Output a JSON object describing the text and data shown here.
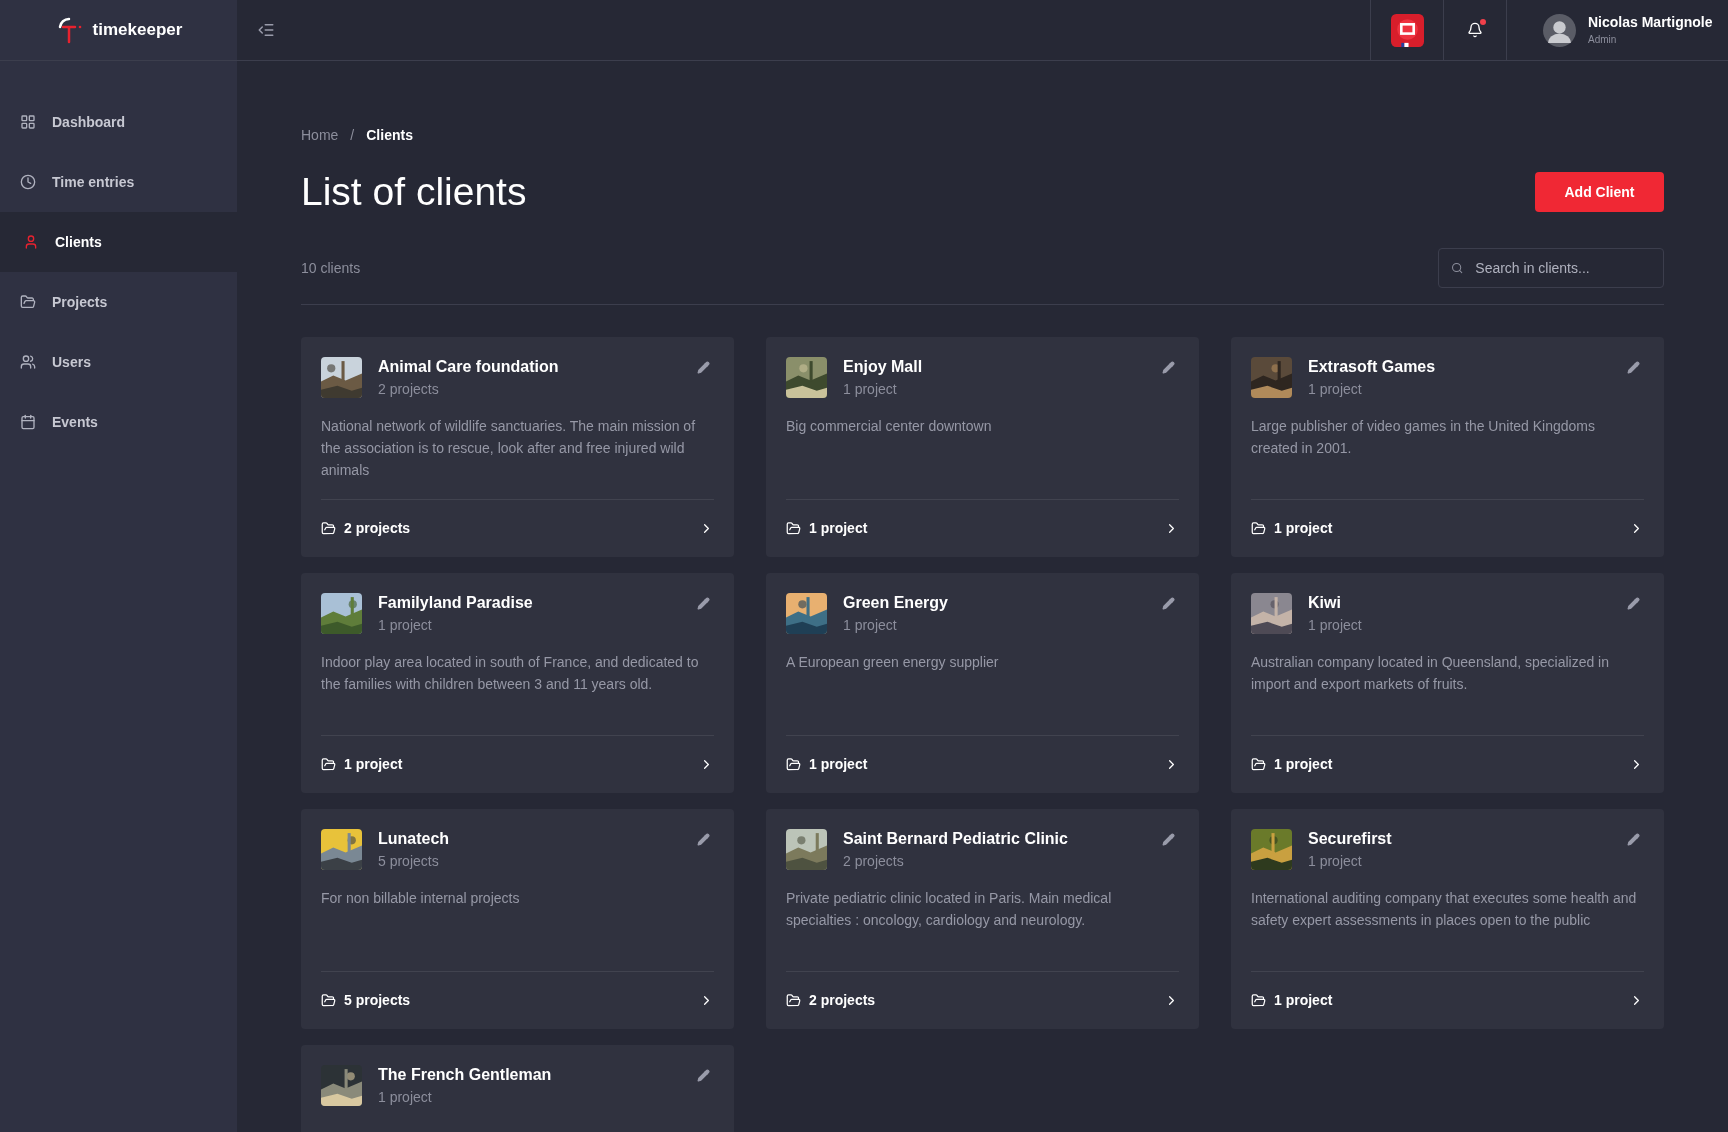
{
  "brand": {
    "name": "timekeeper"
  },
  "sidebar": {
    "items": [
      {
        "label": "Dashboard",
        "selected": false
      },
      {
        "label": "Time entries",
        "selected": false
      },
      {
        "label": "Clients",
        "selected": true
      },
      {
        "label": "Projects",
        "selected": false
      },
      {
        "label": "Users",
        "selected": false
      },
      {
        "label": "Events",
        "selected": false
      }
    ]
  },
  "user": {
    "name": "Nicolas Martignole",
    "role": "Admin",
    "notifications": true
  },
  "breadcrumb": {
    "items": [
      "Home",
      "Clients"
    ],
    "separator": "/"
  },
  "title": "List of clients",
  "add_button": "Add Client",
  "count": "10 clients",
  "search": {
    "placeholder": "Search in clients..."
  },
  "clients": [
    {
      "name": "Animal Care foundation",
      "subtitle": "2 projects",
      "description": "National network of wildlife sanctuaries. The main mission of the association is to rescue, look after and free injured wild animals",
      "footer": "2 projects"
    },
    {
      "name": "Enjoy Mall",
      "subtitle": "1 project",
      "description": "Big commercial center downtown",
      "footer": "1 project"
    },
    {
      "name": "Extrasoft Games",
      "subtitle": "1 project",
      "description": "Large publisher of video games in the United Kingdoms created in 2001.",
      "footer": "1 project"
    },
    {
      "name": "Familyland Paradise",
      "subtitle": "1 project",
      "description": "Indoor play area located in south of France, and dedicated to the families with children between 3 and 11 years old.",
      "footer": "1 project"
    },
    {
      "name": "Green Energy",
      "subtitle": "1 project",
      "description": "A European green energy supplier",
      "footer": "1 project"
    },
    {
      "name": "Kiwi",
      "subtitle": "1 project",
      "description": "Australian company located in Queensland, specialized in import and export markets of fruits.",
      "footer": "1 project"
    },
    {
      "name": "Lunatech",
      "subtitle": "5 projects",
      "description": "For non billable internal projects",
      "footer": "5 projects"
    },
    {
      "name": "Saint Bernard Pediatric Clinic",
      "subtitle": "2 projects",
      "description": "Private pediatric clinic located in Paris. Main medical specialties : oncology, cardiology and neurology.",
      "footer": "2 projects"
    },
    {
      "name": "Securefirst",
      "subtitle": "1 project",
      "description": "International auditing company that executes some health and safety expert assessments in places open to the public",
      "footer": "1 project"
    },
    {
      "name": "The French Gentleman",
      "subtitle": "1 project"
    }
  ]
}
